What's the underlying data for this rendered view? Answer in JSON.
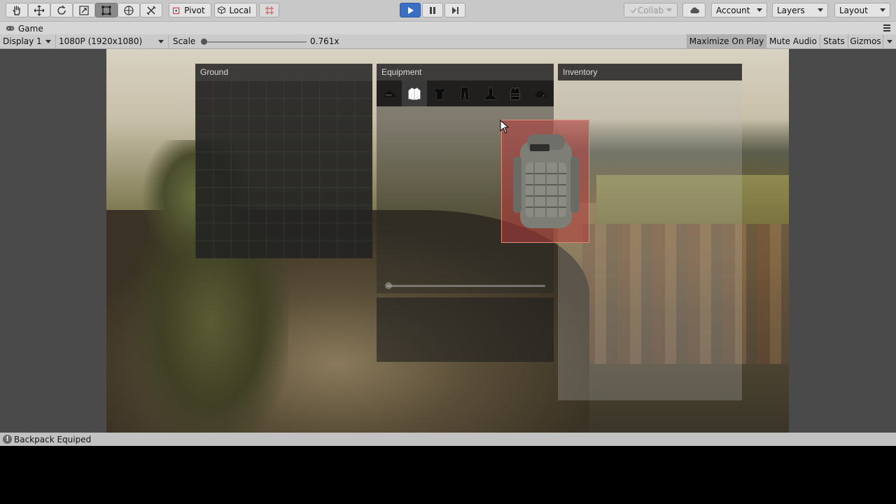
{
  "toolbar": {
    "pivot_label": "Pivot",
    "local_label": "Local",
    "collab_label": "Collab",
    "account_label": "Account",
    "layers_label": "Layers",
    "layout_label": "Layout"
  },
  "tab": {
    "title": "Game"
  },
  "game_bar": {
    "display": "Display 1",
    "resolution": "1080P (1920x1080)",
    "scale_label": "Scale",
    "scale_value": "0.761x",
    "maximize_on_play": "Maximize On Play",
    "mute_audio": "Mute Audio",
    "stats": "Stats",
    "gizmos": "Gizmos"
  },
  "panels": {
    "ground": {
      "title": "Ground"
    },
    "equipment": {
      "title": "Equipment",
      "slots": [
        "helmet",
        "jacket",
        "shirt",
        "pants",
        "boots",
        "vest",
        "mask"
      ]
    },
    "inventory": {
      "title": "Inventory"
    }
  },
  "status": {
    "message": "Backpack Equiped"
  },
  "colors": {
    "play_button": "#3a6fc4",
    "drag_highlight": "#b43c3c",
    "panel_header": "#282828"
  }
}
